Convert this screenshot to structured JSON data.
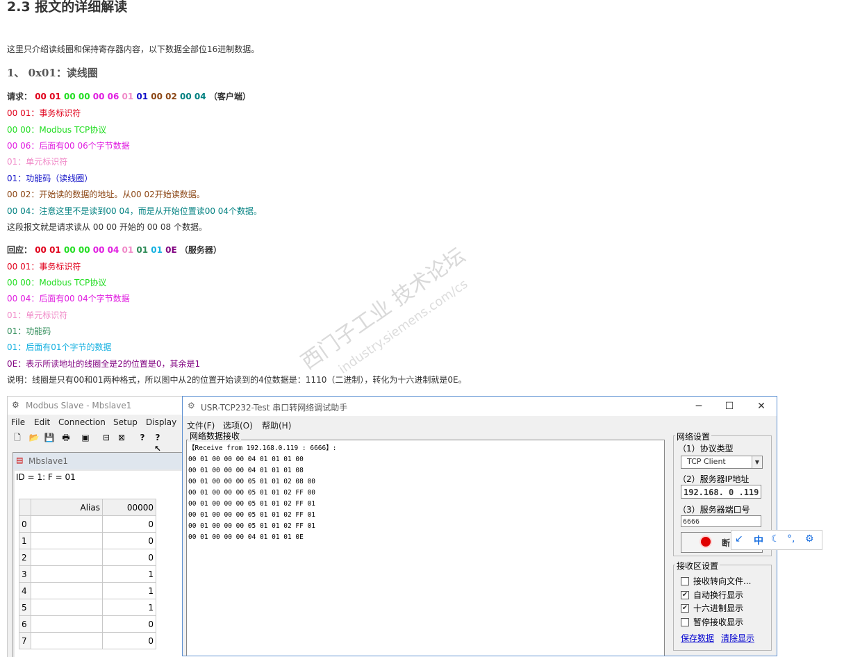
{
  "article": {
    "heading": "2.3 报文的详细解读",
    "intro": "这里只介绍读线圈和保持寄存器内容，以下数据全部位16进制数据。",
    "section_title": "1、 0x01：读线圈",
    "request": {
      "label": "请求：",
      "bytes": [
        "00 01",
        "00 00",
        "00 06",
        "01",
        "01",
        "00 02",
        "00 04"
      ],
      "suffix": "（客户端）",
      "notes": [
        "00 01：事务标识符",
        "00 00：Modbus TCP协议",
        "00 06：后面有00 06个字节数据",
        "01：单元标识符",
        "01：功能码（读线圈）",
        "00 02：开始读的数据的地址。从00 02开始读数据。",
        "00 04：注意这里不是读到00 04，而是从开始位置读00 04个数据。"
      ],
      "summary": "这段报文就是请求读从 00 00 开始的 00 08 个数据。"
    },
    "response": {
      "label": "回应：",
      "bytes": [
        "00 01",
        "00 00",
        "00 04",
        "01",
        "01",
        "01",
        "0E"
      ],
      "suffix": "（服务器）",
      "notes": [
        "00 01：事务标识符",
        "00 00：Modbus TCP协议",
        "00 04：后面有00 04个字节数据",
        "01：单元标识符",
        "01：功能码",
        "01：后面有01个字节的数据",
        "0E：表示所读地址的线圈全是2的位置是0，其余是1"
      ],
      "explanation": "说明：线圈是只有00和01两种格式，所以图中从2的位置开始读到的4位数据是：1110（二进制），转化为十六进制就是0E。"
    },
    "watermark": "西门子工业 技术论坛",
    "watermark_url": "industry.siemens.com/cs"
  },
  "modbus_slave": {
    "title": "Modbus Slave - Mbslave1",
    "menu": [
      "File",
      "Edit",
      "Connection",
      "Setup",
      "Display"
    ],
    "child_title": "Mbslave1",
    "id_line": "ID = 1: F = 01",
    "columns": [
      "Alias",
      "00000"
    ],
    "rows": [
      {
        "index": "0",
        "value": "0"
      },
      {
        "index": "1",
        "value": "0"
      },
      {
        "index": "2",
        "value": "0"
      },
      {
        "index": "3",
        "value": "1"
      },
      {
        "index": "4",
        "value": "1"
      },
      {
        "index": "5",
        "value": "1"
      },
      {
        "index": "6",
        "value": "0"
      },
      {
        "index": "7",
        "value": "0"
      }
    ]
  },
  "usr_tool": {
    "title": "USR-TCP232-Test 串口转网络调试助手",
    "menu": [
      "文件(F)",
      "选项(O)",
      "帮助(H)"
    ],
    "recv_group": "网络数据接收",
    "recv_lines": [
      "【Receive from 192.168.0.119 : 6666】:",
      "00 01 00 00 00 04 01 01 01 00",
      "00 01 00 00 00 04 01 01 01 08",
      "00 01 00 00 00 05 01 01 02 08 00",
      "00 01 00 00 00 05 01 01 02 FF 00",
      "00 01 00 00 00 05 01 01 02 FF 01",
      "00 01 00 00 00 05 01 01 02 FF 01",
      "00 01 00 00 00 05 01 01 02 FF 01",
      "00 01 00 00 00 04 01 01 01 0E"
    ],
    "net_settings": {
      "group": "网络设置",
      "protocol_label": "（1）协议类型",
      "protocol_value": "TCP Client",
      "ip_label": "（2）服务器IP地址",
      "ip_value": "192.168. 0 .119",
      "port_label": "（3）服务器端口号",
      "port_value": "6666",
      "connect_label": "断"
    },
    "rx_settings": {
      "group": "接收区设置",
      "options": [
        {
          "label": "接收转向文件...",
          "checked": false
        },
        {
          "label": "自动换行显示",
          "checked": true
        },
        {
          "label": "十六进制显示",
          "checked": true
        },
        {
          "label": "暂停接收显示",
          "checked": false
        }
      ],
      "save_link": "保存数据",
      "clear_link": "清除显示"
    },
    "ime_toolbar": {
      "lang": "中",
      "punct": "°,"
    }
  }
}
